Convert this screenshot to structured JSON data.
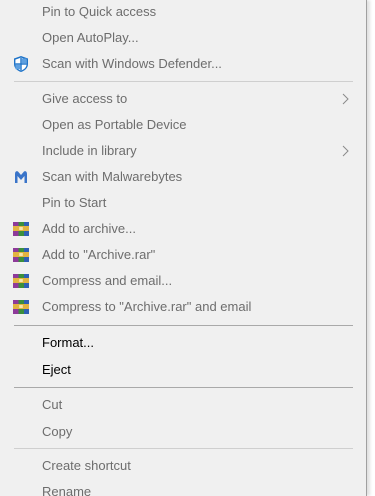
{
  "menu": {
    "items": [
      {
        "label": "Pin to Quick access"
      },
      {
        "label": "Open AutoPlay..."
      },
      {
        "label": "Scan with Windows Defender...",
        "icon": "windows-defender-icon"
      },
      {
        "label": "Give access to",
        "submenu": true
      },
      {
        "label": "Open as Portable Device"
      },
      {
        "label": "Include in library",
        "submenu": true
      },
      {
        "label": "Scan with Malwarebytes",
        "icon": "malwarebytes-icon"
      },
      {
        "label": "Pin to Start"
      },
      {
        "label": "Add to archive...",
        "icon": "winrar-icon"
      },
      {
        "label": "Add to \"Archive.rar\"",
        "icon": "winrar-icon"
      },
      {
        "label": "Compress and email...",
        "icon": "winrar-icon"
      },
      {
        "label": "Compress to \"Archive.rar\" and email",
        "icon": "winrar-icon"
      },
      {
        "label": "Format..."
      },
      {
        "label": "Eject"
      },
      {
        "label": "Cut"
      },
      {
        "label": "Copy"
      },
      {
        "label": "Create shortcut"
      },
      {
        "label": "Rename"
      }
    ]
  },
  "colors": {
    "menu_background": "#f0f0f0",
    "disabled_text": "#6d6d6d",
    "enabled_text": "#000000",
    "defender_blue": "#1e73c8",
    "malwarebytes_blue": "#3a74c9"
  }
}
